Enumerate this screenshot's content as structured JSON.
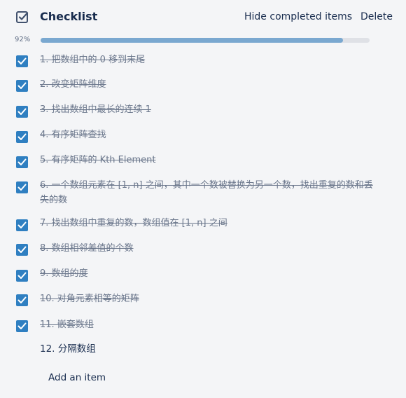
{
  "checklist": {
    "title": "Checklist",
    "hide_completed_label": "Hide completed items",
    "delete_label": "Delete",
    "progress_label": "92%",
    "progress_fraction": 0.92,
    "accent_color": "#2f7fc1",
    "progress_color": "#7aa8d0",
    "items": [
      {
        "text": "1. 把数组中的 0 移到末尾",
        "checked": true
      },
      {
        "text": "2. 改变矩阵维度",
        "checked": true
      },
      {
        "text": "3. 找出数组中最长的连续 1",
        "checked": true
      },
      {
        "text": "4. 有序矩阵查找",
        "checked": true
      },
      {
        "text": "5. 有序矩阵的 Kth Element",
        "checked": true
      },
      {
        "text": "6. 一个数组元素在 [1, n] 之间，其中一个数被替换为另一个数，找出重复的数和丢失的数",
        "checked": true
      },
      {
        "text": "7. 找出数组中重复的数，数组值在 [1, n] 之间",
        "checked": true
      },
      {
        "text": "8. 数组相邻差值的个数",
        "checked": true
      },
      {
        "text": "9. 数组的度",
        "checked": true
      },
      {
        "text": "10. 对角元素相等的矩阵",
        "checked": true
      },
      {
        "text": "11. 嵌套数组",
        "checked": true
      },
      {
        "text": "12. 分隔数组",
        "checked": false
      }
    ],
    "add_item_label": "Add an item"
  }
}
